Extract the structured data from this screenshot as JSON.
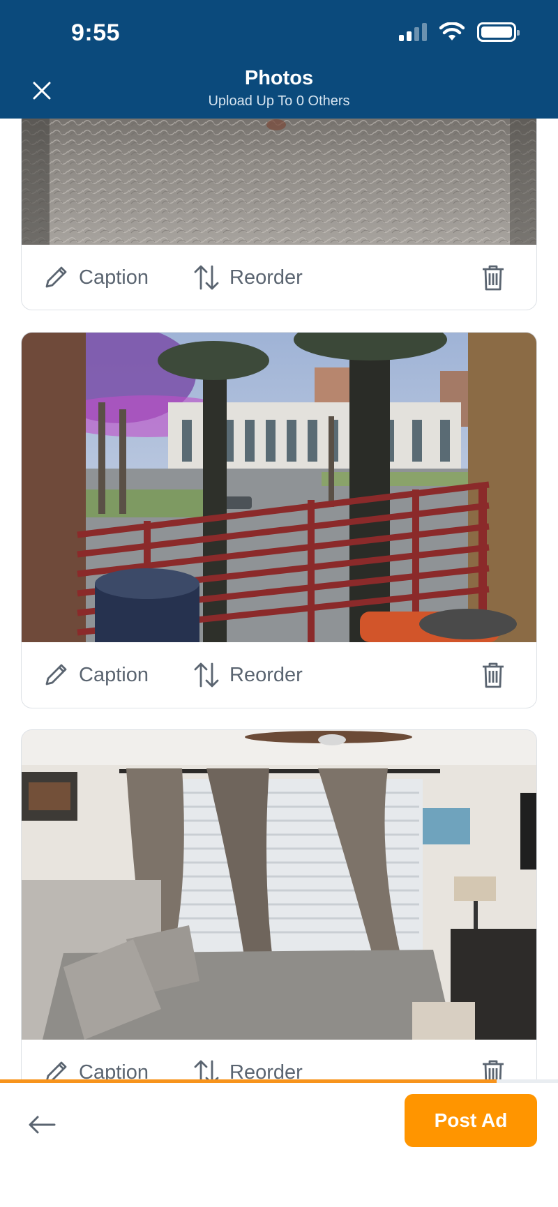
{
  "status_bar": {
    "time": "9:55"
  },
  "header": {
    "title": "Photos",
    "subtitle": "Upload Up To 0 Others",
    "close_icon": "close-icon"
  },
  "photos": [
    {
      "subject": "fluffy gray rug",
      "caption_label": "Caption",
      "reorder_label": "Reorder"
    },
    {
      "subject": "balcony with palm trees and city view",
      "caption_label": "Caption",
      "reorder_label": "Reorder"
    },
    {
      "subject": "bedroom with curtains and bed",
      "caption_label": "Caption",
      "reorder_label": "Reorder"
    }
  ],
  "upload_progress": 0.89,
  "footer": {
    "post_label": "Post Ad",
    "back_icon": "arrow-left-icon"
  },
  "colors": {
    "header_bg": "#0b4a7c",
    "accent": "#ff9500",
    "progress": "#f7941d",
    "action_text": "#5a6470"
  }
}
